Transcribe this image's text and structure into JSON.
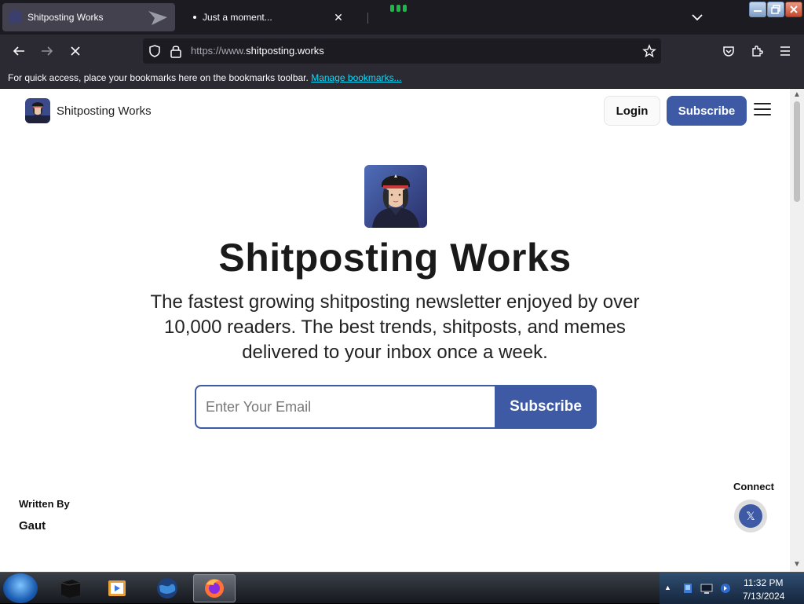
{
  "browser": {
    "tabs": [
      {
        "title": "Shitposting Works",
        "active": true
      },
      {
        "title": "Just a moment...",
        "active": false,
        "loading": true
      }
    ],
    "url": {
      "prefix": "https://www.",
      "domain": "shitposting.works"
    },
    "bookmarks_message": "For quick access, place your bookmarks here on the bookmarks toolbar.",
    "bookmarks_link": "Manage bookmarks..."
  },
  "site": {
    "brand_name": "Shitposting Works",
    "login_label": "Login",
    "subscribe_label": "Subscribe",
    "hero_title": "Shitposting Works",
    "hero_description": "The fastest growing shitposting newsletter enjoyed by over 10,000 readers. The best trends, shitposts, and memes delivered to your inbox once a week.",
    "email_placeholder": "Enter Your Email",
    "subscribe_hero_label": "Subscribe",
    "written_by_label": "Written By",
    "author": "Gaut",
    "connect_label": "Connect",
    "social_icon": "x-icon"
  },
  "taskbar": {
    "time": "11:32 PM",
    "date": "7/13/2024",
    "apps": [
      "file-manager",
      "media-player",
      "globe-browser",
      "firefox"
    ]
  },
  "colors": {
    "accent": "#3e5aa5",
    "chrome_dark": "#1c1b22",
    "toolbar": "#2b2a33",
    "link": "#00ddff"
  }
}
